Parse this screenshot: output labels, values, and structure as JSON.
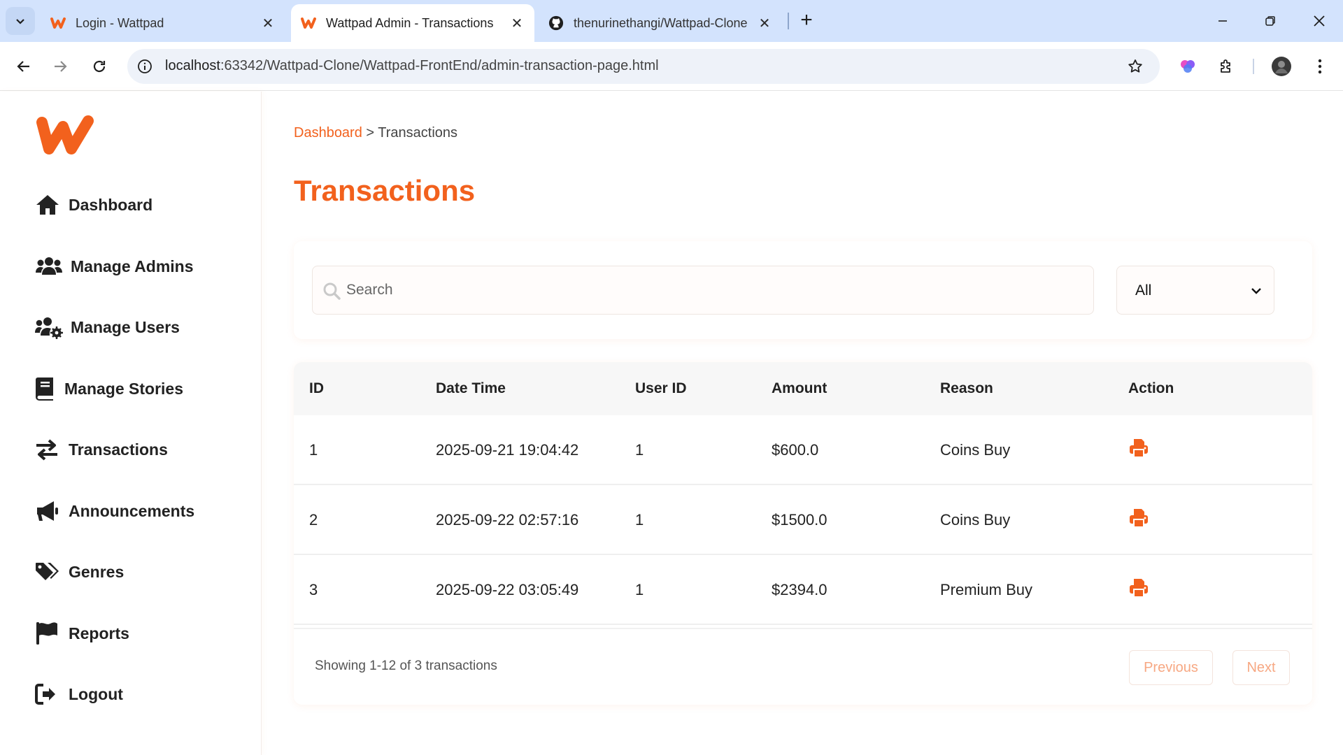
{
  "browser": {
    "tabs": [
      {
        "title": "Login - Wattpad",
        "active": false
      },
      {
        "title": "Wattpad Admin - Transactions",
        "active": true
      },
      {
        "title": "thenurinethangi/Wattpad-Clone",
        "active": false
      }
    ],
    "url_host": "localhost",
    "url_path": ":63342/Wattpad-Clone/Wattpad-FrontEnd/admin-transaction-page.html"
  },
  "sidebar": {
    "items": [
      {
        "label": "Dashboard",
        "icon": "home-icon"
      },
      {
        "label": "Manage Admins",
        "icon": "users-icon"
      },
      {
        "label": "Manage Users",
        "icon": "users-cog-icon"
      },
      {
        "label": "Manage Stories",
        "icon": "book-icon"
      },
      {
        "label": "Transactions",
        "icon": "exchange-icon"
      },
      {
        "label": "Announcements",
        "icon": "megaphone-icon"
      },
      {
        "label": "Genres",
        "icon": "tags-icon"
      },
      {
        "label": "Reports",
        "icon": "flag-icon"
      },
      {
        "label": "Logout",
        "icon": "logout-icon"
      }
    ]
  },
  "breadcrumb": {
    "link": "Dashboard",
    "separator": ">",
    "current": "Transactions"
  },
  "page_title": "Transactions",
  "filter": {
    "search_placeholder": "Search",
    "select_value": "All"
  },
  "table": {
    "headers": [
      "ID",
      "Date Time",
      "User ID",
      "Amount",
      "Reason",
      "Action"
    ],
    "rows": [
      {
        "id": "1",
        "datetime": "2025-09-21 19:04:42",
        "user_id": "1",
        "amount": "$600.0",
        "reason": "Coins Buy"
      },
      {
        "id": "2",
        "datetime": "2025-09-22 02:57:16",
        "user_id": "1",
        "amount": "$1500.0",
        "reason": "Coins Buy"
      },
      {
        "id": "3",
        "datetime": "2025-09-22 03:05:49",
        "user_id": "1",
        "amount": "$2394.0",
        "reason": "Premium Buy"
      }
    ]
  },
  "pagination": {
    "showing": "Showing 1-12 of 3 transactions",
    "previous": "Previous",
    "next": "Next"
  },
  "colors": {
    "accent": "#f2611d"
  }
}
